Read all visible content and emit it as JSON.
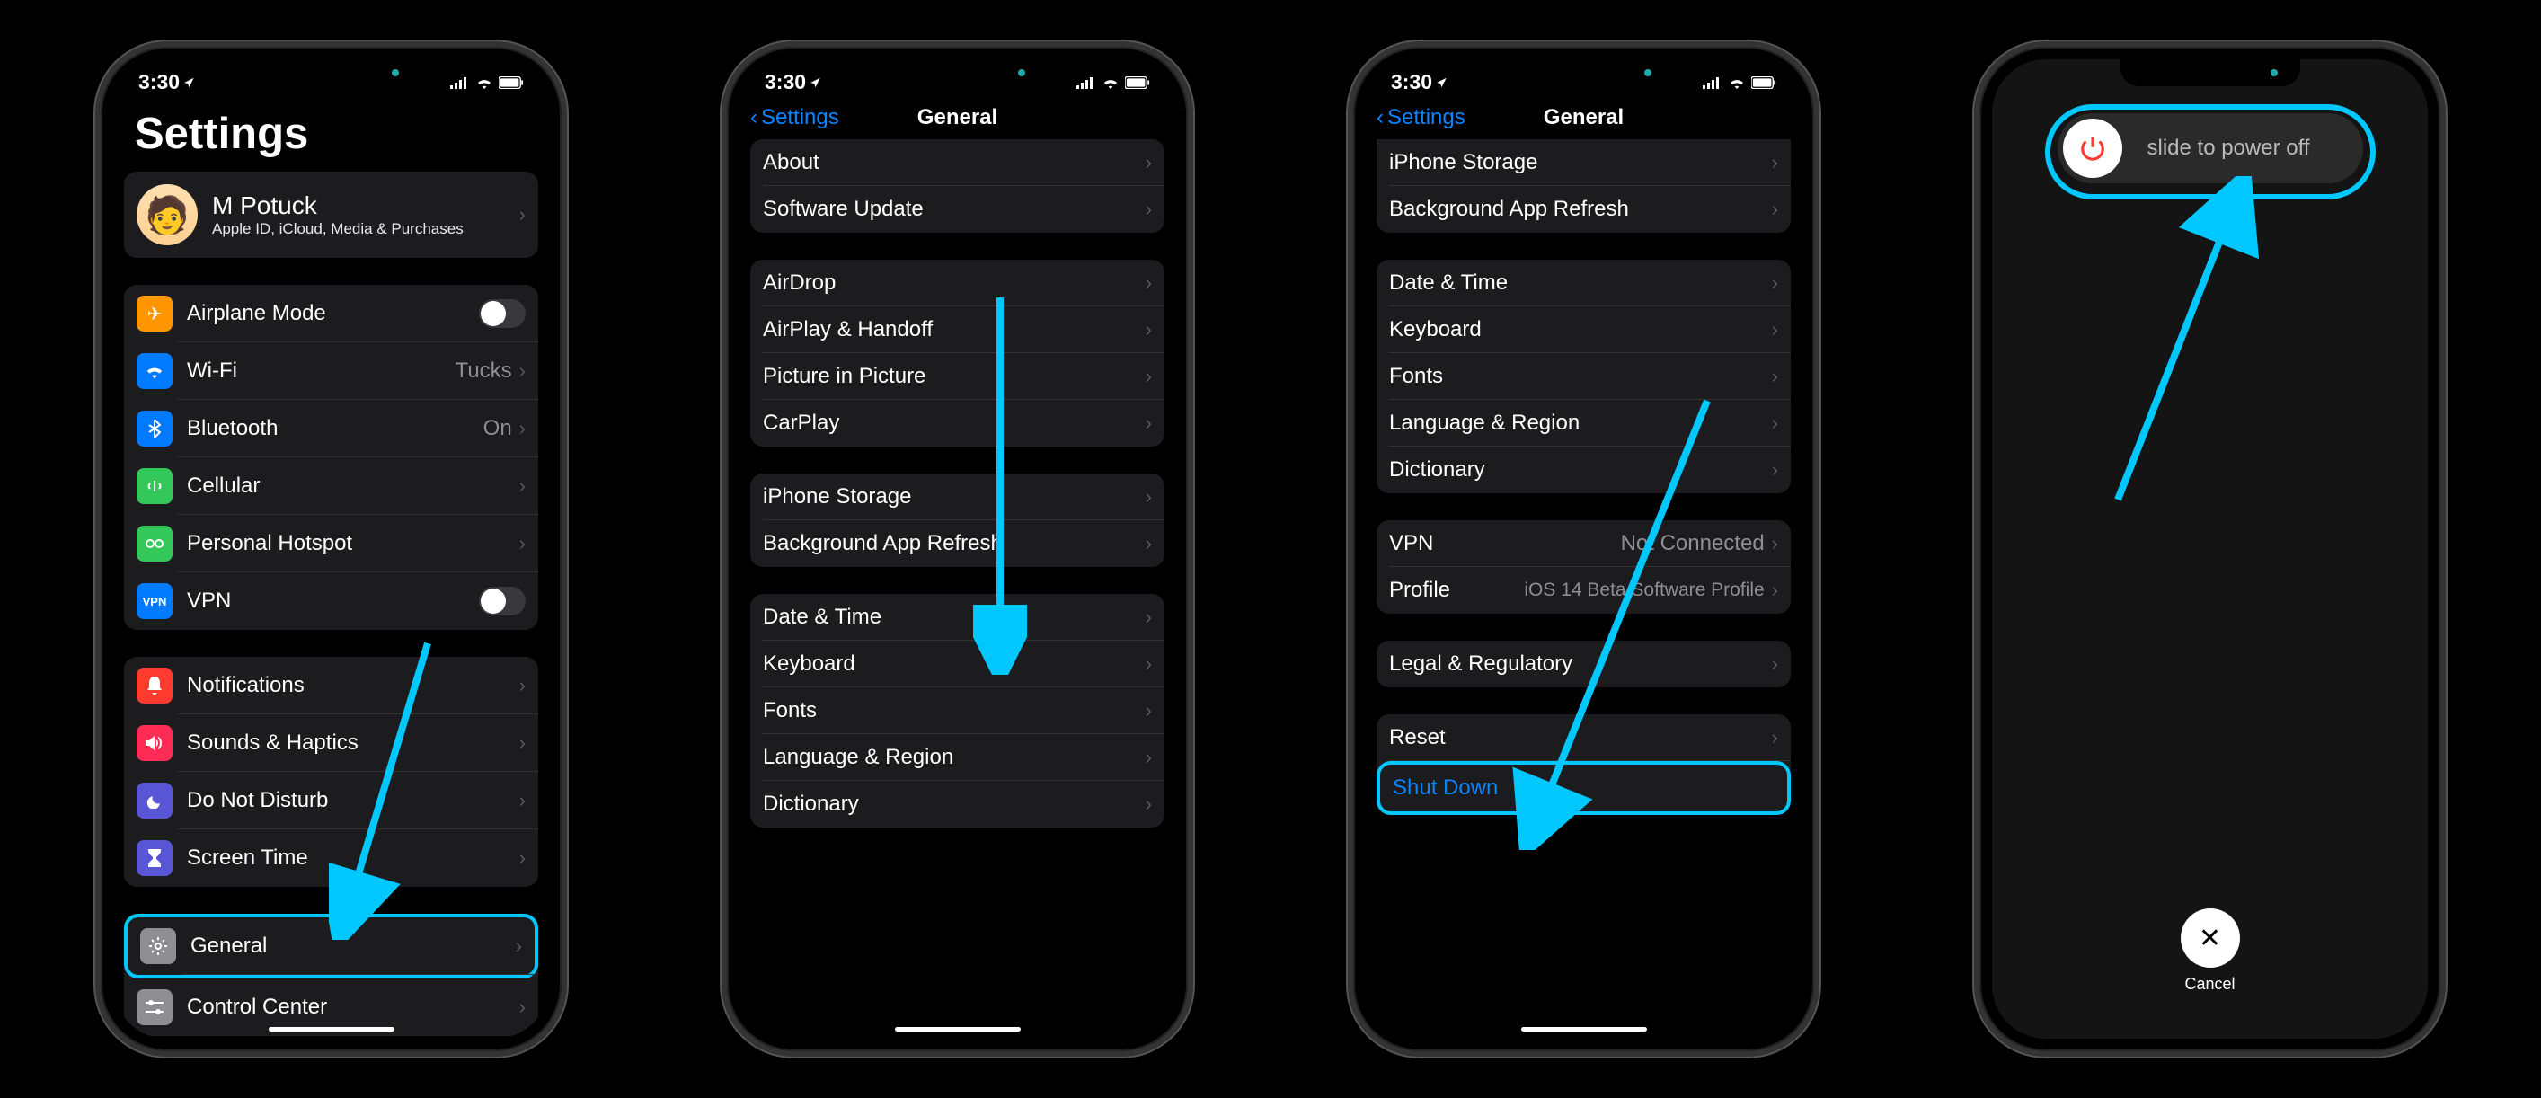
{
  "status": {
    "time": "3:30",
    "location_arrow": "↗"
  },
  "colors": {
    "highlight": "#00c8ff",
    "link": "#0a84ff"
  },
  "phone1": {
    "title": "Settings",
    "profile": {
      "name": "M Potuck",
      "sub": "Apple ID, iCloud, Media & Purchases"
    },
    "g1": [
      {
        "icon": "✈︎",
        "bg": "#ff9500",
        "label": "Airplane Mode",
        "toggle": true
      },
      {
        "icon": "wifi",
        "bg": "#007aff",
        "label": "Wi-Fi",
        "value": "Tucks"
      },
      {
        "icon": "bt",
        "bg": "#007aff",
        "label": "Bluetooth",
        "value": "On"
      },
      {
        "icon": "cell",
        "bg": "#34c759",
        "label": "Cellular"
      },
      {
        "icon": "link",
        "bg": "#34c759",
        "label": "Personal Hotspot"
      },
      {
        "icon": "vpn",
        "bg": "#007aff",
        "label": "VPN",
        "toggle": true
      }
    ],
    "g2": [
      {
        "icon": "notif",
        "bg": "#ff3b30",
        "label": "Notifications"
      },
      {
        "icon": "sound",
        "bg": "#ff2d55",
        "label": "Sounds & Haptics"
      },
      {
        "icon": "moon",
        "bg": "#5856d6",
        "label": "Do Not Disturb"
      },
      {
        "icon": "hourglass",
        "bg": "#5856d6",
        "label": "Screen Time"
      }
    ],
    "g3": [
      {
        "icon": "gear",
        "bg": "#8e8e93",
        "label": "General"
      },
      {
        "icon": "ctrl",
        "bg": "#8e8e93",
        "label": "Control Center"
      }
    ]
  },
  "phone2": {
    "back": "Settings",
    "title": "General",
    "g1": [
      {
        "label": "About"
      },
      {
        "label": "Software Update"
      }
    ],
    "g2": [
      {
        "label": "AirDrop"
      },
      {
        "label": "AirPlay & Handoff"
      },
      {
        "label": "Picture in Picture"
      },
      {
        "label": "CarPlay"
      }
    ],
    "g3": [
      {
        "label": "iPhone Storage"
      },
      {
        "label": "Background App Refresh"
      }
    ],
    "g4": [
      {
        "label": "Date & Time"
      },
      {
        "label": "Keyboard"
      },
      {
        "label": "Fonts"
      },
      {
        "label": "Language & Region"
      },
      {
        "label": "Dictionary"
      }
    ]
  },
  "phone3": {
    "back": "Settings",
    "title": "General",
    "g1": [
      {
        "label": "iPhone Storage"
      },
      {
        "label": "Background App Refresh"
      }
    ],
    "g2": [
      {
        "label": "Date & Time"
      },
      {
        "label": "Keyboard"
      },
      {
        "label": "Fonts"
      },
      {
        "label": "Language & Region"
      },
      {
        "label": "Dictionary"
      }
    ],
    "g3": [
      {
        "label": "VPN",
        "value": "Not Connected"
      },
      {
        "label": "Profile",
        "value": "iOS 14 Beta Software Profile"
      }
    ],
    "g4": [
      {
        "label": "Legal & Regulatory"
      }
    ],
    "g5": [
      {
        "label": "Reset"
      },
      {
        "label": "Shut Down",
        "blue": true
      }
    ]
  },
  "phone4": {
    "slide": "slide to power off",
    "cancel": "Cancel"
  }
}
